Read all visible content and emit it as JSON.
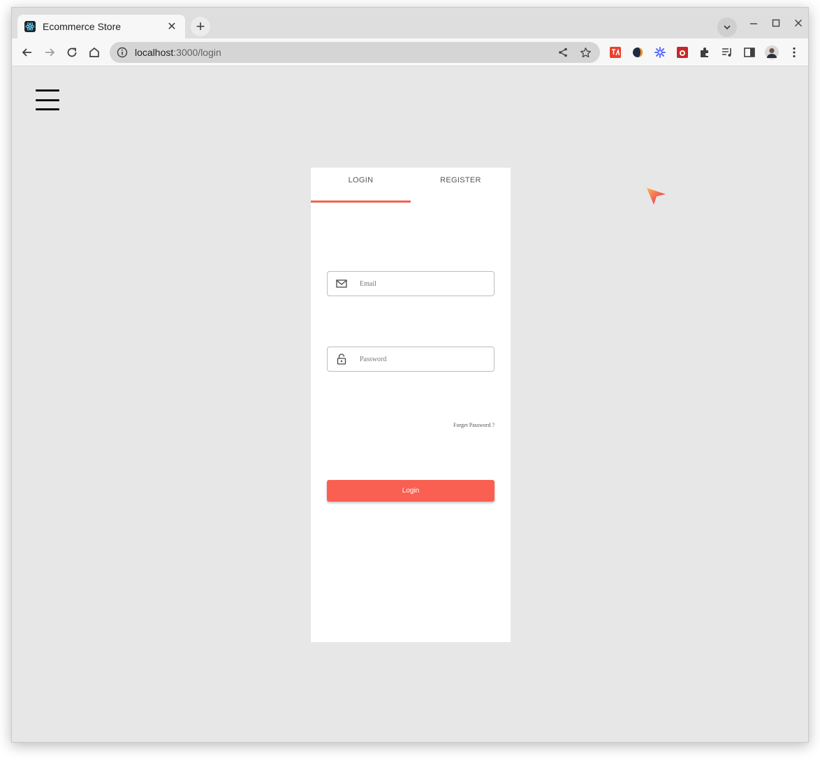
{
  "browser": {
    "tab_title": "Ecommerce Store",
    "url_host": "localhost",
    "url_path": ":3000/login"
  },
  "auth": {
    "tabs": [
      {
        "label": "LOGIN",
        "active": true
      },
      {
        "label": "REGISTER",
        "active": false
      }
    ],
    "email_placeholder": "Email",
    "password_placeholder": "Password",
    "forgot_password": "Forget Password ?",
    "login_button": "Login"
  },
  "colors": {
    "accent": "#f96052",
    "tab_indicator": "#f16352",
    "page_bg": "#e7e7e7"
  },
  "icons": {
    "hamburger": "menu-icon",
    "email": "mail-icon",
    "password": "lock-icon",
    "cursor": "pointer-arrow-icon"
  }
}
